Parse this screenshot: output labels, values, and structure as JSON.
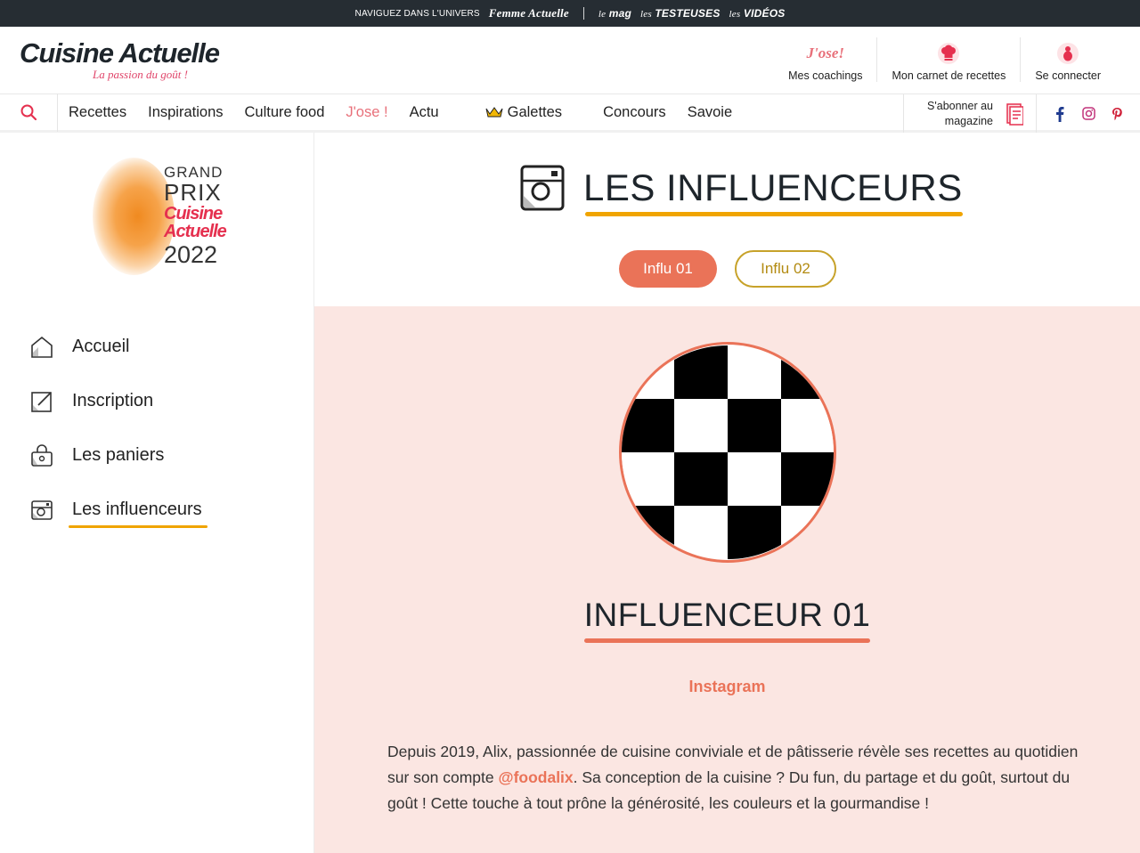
{
  "topbar": {
    "label": "NAVIGUEZ DANS L'UNIVERS",
    "brand": "Femme Actuelle",
    "links": [
      {
        "prefix": "le",
        "name": "mag"
      },
      {
        "prefix": "les",
        "name": "TESTEUSES"
      },
      {
        "prefix": "les",
        "name": "VIDÉOS"
      }
    ]
  },
  "header": {
    "logo_title": "Cuisine Actuelle",
    "logo_tagline": "La passion du goût !",
    "actions": [
      {
        "label": "Mes coachings",
        "icon": "jose-logo",
        "logo_text": "J'ose!"
      },
      {
        "label": "Mon carnet de recettes",
        "icon": "chef-hat-icon"
      },
      {
        "label": "Se connecter",
        "icon": "user-icon"
      }
    ]
  },
  "nav": {
    "items": [
      "Recettes",
      "Inspirations",
      "Culture food",
      "J'ose !",
      "Actu",
      "Galettes",
      "Concours",
      "Savoie"
    ],
    "subscribe_label": "S'abonner au magazine"
  },
  "sidebar": {
    "gp_logo": {
      "line1": "GRAND",
      "line2": "PRIX",
      "brand1": "Cuisine",
      "brand2": "Actuelle",
      "year": "2022"
    },
    "menu": [
      {
        "label": "Accueil",
        "icon": "home-icon"
      },
      {
        "label": "Inscription",
        "icon": "edit-icon"
      },
      {
        "label": "Les paniers",
        "icon": "basket-icon"
      },
      {
        "label": "Les influenceurs",
        "icon": "camera-icon",
        "active": true
      }
    ]
  },
  "main": {
    "title": "LES INFLUENCEURS",
    "tabs": [
      {
        "label": "Influ 01",
        "active": true
      },
      {
        "label": "Influ 02",
        "active": false
      }
    ],
    "influencer": {
      "name": "INFLUENCEUR 01",
      "platform": "Instagram",
      "desc_part1": "Depuis 2019, Alix, passionnée de cuisine conviviale et de pâtisserie révèle ses recettes au quotidien sur son compte ",
      "handle": "@foodalix",
      "desc_part2": ". Sa conception de la cuisine ? Du fun, du partage et du goût, surtout du goût ! Cette touche à tout prône la générosité, les couleurs et la gourmandise !"
    }
  },
  "colors": {
    "accent_coral": "#ea7358",
    "accent_gold": "#f0a400",
    "jose_pink": "#e8707a",
    "brand_red": "#e5304f",
    "panel_bg": "#fbe6e2",
    "topbar_bg": "#262d33"
  }
}
